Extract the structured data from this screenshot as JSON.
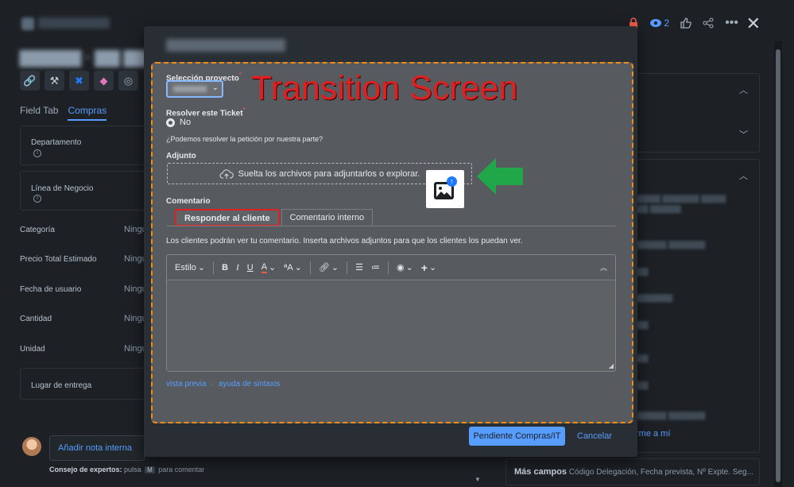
{
  "header": {
    "watch_count": "2"
  },
  "issue": {
    "tabs": [
      "Field Tab",
      "Compras"
    ],
    "fields": {
      "departamento": "Departamento",
      "linea_negocio": "Línea de Negocio",
      "categoria": "Categoría",
      "precio": "Precio Total Estimado",
      "fecha": "Fecha de usuario",
      "cantidad": "Cantidad",
      "unidad": "Unidad",
      "lugar": "Lugar de entrega",
      "empty_value": "Ningu"
    },
    "assign_to_me": "rme a mí",
    "more_fields_label": "Más campos",
    "more_fields_list": "Código Delegación, Fecha prevista, Nº Expte. Seg...",
    "comment_placeholder": "Añadir nota interna",
    "comment_sep": "/",
    "expert_tip_prefix": "Consejo de expertos:",
    "expert_tip_mid": "pulsa",
    "expert_tip_key": "M",
    "expert_tip_suffix": "para comentar"
  },
  "modal": {
    "annotation": "Transition Screen",
    "project_label": "Selección proyecto",
    "required_mark": "*",
    "resolve_label": "Resolver este Ticket",
    "resolve_option": "No",
    "resolve_help": "¿Podemos resolver la petición por nuestra parte?",
    "attachment_label": "Adjunto",
    "dropzone_text": "Suelta los archivos para adjuntarlos o explorar.",
    "comment_label": "Comentario",
    "tab_reply": "Responder al cliente",
    "tab_internal": "Comentario interno",
    "client_note": "Los clientes podrán ver tu comentario. Inserta archivos adjuntos para que los clientes los puedan ver.",
    "toolbar": {
      "style": "Estilo",
      "bold": "B",
      "italic": "I",
      "underline": "U",
      "text_color": "A",
      "more_format": "ªA",
      "plus": "+"
    },
    "preview_link": "vista previa",
    "link_sep": "·",
    "syntax_link": "ayuda de sintaxis",
    "submit_label": "Pendiente Compras/IT",
    "cancel_label": "Cancelar"
  },
  "colors": {
    "accent": "#579dff",
    "annotation_red": "#e02020",
    "frame_orange": "#f18d13",
    "arrow_green": "#1fa74a"
  }
}
